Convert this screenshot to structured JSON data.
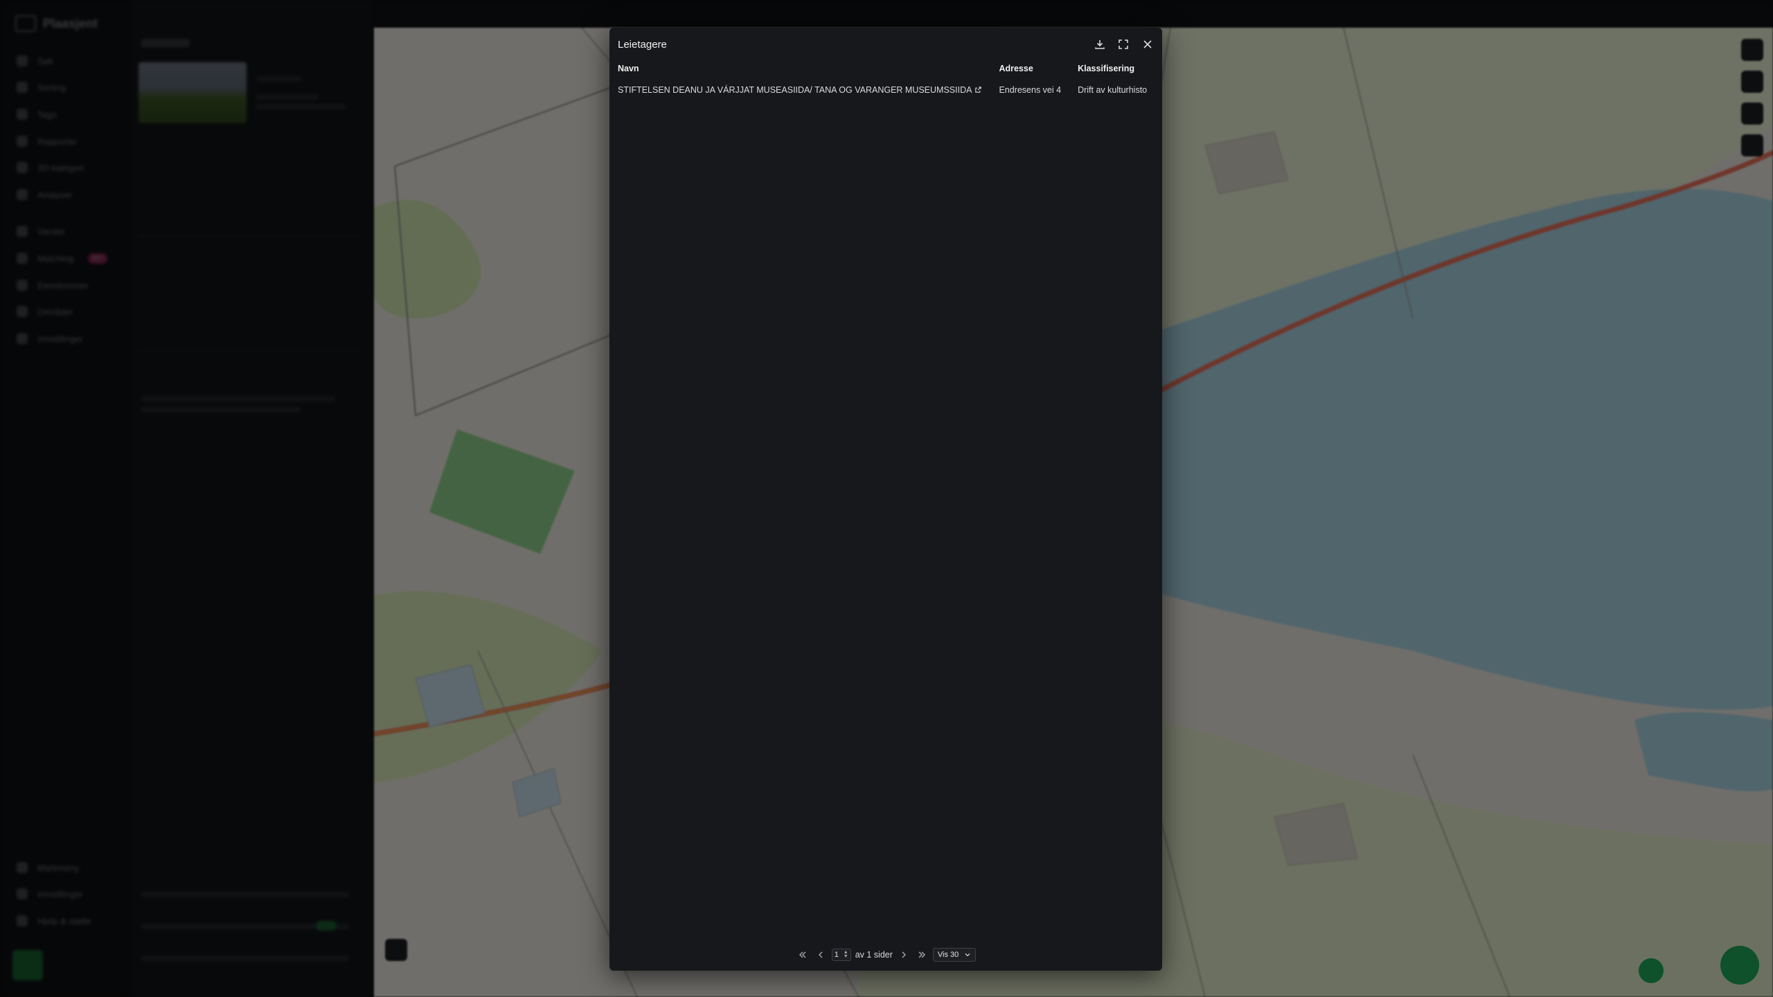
{
  "app": {
    "brand": "Plaasjent"
  },
  "nav": {
    "items": [
      {
        "label": "Søk"
      },
      {
        "label": "Sorting"
      },
      {
        "label": "Tags"
      },
      {
        "label": "Rapporter"
      },
      {
        "label": "3D-kategori"
      },
      {
        "label": "Analyser"
      },
      {
        "label": "Varsler"
      },
      {
        "label": "Matching",
        "badge": "NY"
      },
      {
        "label": "Eiendommer"
      },
      {
        "label": "Områder"
      },
      {
        "label": "Innstillinger"
      }
    ],
    "bottom": [
      {
        "label": "Markmeny"
      },
      {
        "label": "Innstillinger"
      },
      {
        "label": "Hjelp & støtte"
      }
    ]
  },
  "modal": {
    "title": "Leietagere",
    "columns": [
      "Navn",
      "Adresse",
      "Klassifisering"
    ],
    "rows": [
      {
        "name": "STIFTELSEN DEANU JA VÁRJJAT MUSEASIIDA/ TANA OG VARANGER MUSEUMSSIIDA",
        "address": "Endresens vei 4",
        "classification": "Drift av kulturhisto"
      }
    ],
    "pagination": {
      "page": "1",
      "of_text": "av 1 sider",
      "per_page": "Vis 30"
    }
  },
  "icons": {
    "download": "download-icon",
    "fullscreen": "fullscreen-icon",
    "close": "close-icon",
    "external": "external-link-icon"
  },
  "colors": {
    "modal_bg": "#16181b",
    "accent_green": "#1fa95a",
    "road": "#e8715a",
    "water": "#a9d3e3"
  }
}
